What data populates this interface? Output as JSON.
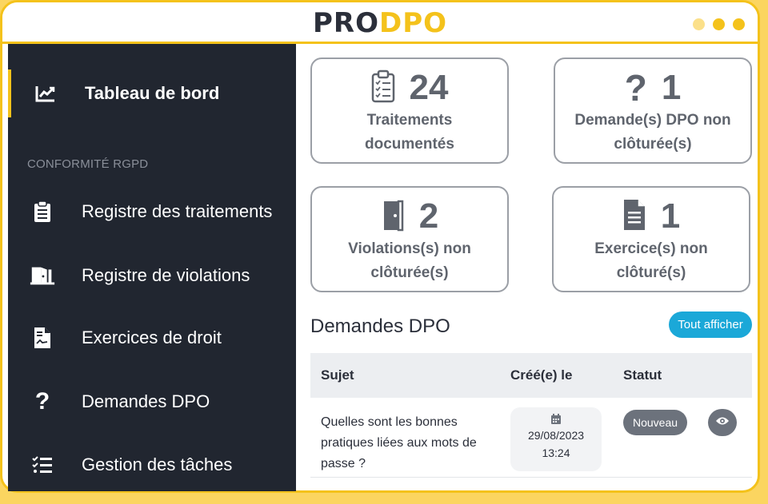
{
  "app": {
    "logo_pro": "PRO",
    "logo_dpo": "DPO",
    "accent": "#f4c21b",
    "sidebar_bg": "#212630"
  },
  "sidebar": {
    "items_top": [
      {
        "label": "Tableau de bord",
        "icon": "chart-line-icon",
        "active": true
      }
    ],
    "section_label": "CONFORMITÉ RGPD",
    "items": [
      {
        "label": "Registre des traitements",
        "icon": "clipboard-list-icon"
      },
      {
        "label": "Registre de violations",
        "icon": "door-open-icon"
      },
      {
        "label": "Exercices de droit",
        "icon": "file-contract-icon"
      },
      {
        "label": "Demandes DPO",
        "icon": "question-icon"
      },
      {
        "label": "Gestion des tâches",
        "icon": "tasks-icon"
      }
    ]
  },
  "stats": [
    {
      "value": "24",
      "label_line1": "Traitements",
      "label_line2": "documentés",
      "icon": "clipboard-list-icon"
    },
    {
      "value": "1",
      "label_line1": "Demande(s) DPO non",
      "label_line2": "clôturée(s)",
      "icon": "question-icon"
    },
    {
      "value": "2",
      "label_line1": "Violations(s) non",
      "label_line2": "clôturée(s)",
      "icon": "door-closed-icon"
    },
    {
      "value": "1",
      "label_line1": "Exercice(s) non",
      "label_line2": "clôturé(s)",
      "icon": "file-lines-icon"
    }
  ],
  "demandes": {
    "title": "Demandes DPO",
    "show_all": "Tout afficher",
    "columns": [
      "Sujet",
      "Créé(e) le",
      "Statut"
    ],
    "rows": [
      {
        "subject": "Quelles sont les bonnes pratiques liées aux mots de passe ?",
        "date": "29/08/2023",
        "time": "13:24",
        "status": "Nouveau"
      }
    ]
  }
}
